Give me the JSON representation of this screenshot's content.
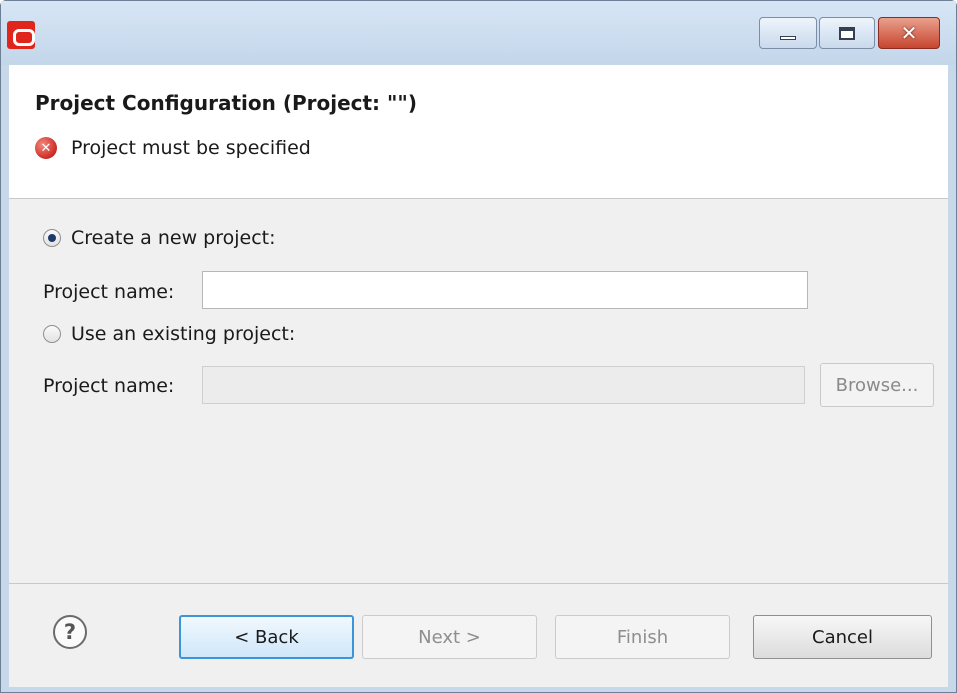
{
  "window": {
    "icon": "oracle-logo-icon",
    "controls": {
      "minimize_icon": "minimize-icon",
      "maximize_icon": "maximize-icon",
      "close_glyph": "✕"
    }
  },
  "header": {
    "title": "Project Configuration (Project: \"\")",
    "error_glyph": "✕",
    "error_message": "Project must be specified"
  },
  "form": {
    "create_new": {
      "label": "Create a new project:",
      "selected": true
    },
    "new_project_name": {
      "label": "Project name:",
      "value": ""
    },
    "use_existing": {
      "label": "Use an existing project:",
      "selected": false
    },
    "existing_project_name": {
      "label": "Project name:",
      "value": "",
      "enabled": false
    },
    "browse_label": "Browse..."
  },
  "footer": {
    "help_glyph": "?",
    "back_label": "< Back",
    "next_label": "Next >",
    "finish_label": "Finish",
    "cancel_label": "Cancel"
  },
  "colors": {
    "error": "#d0302a",
    "focus_border": "#3c95d6",
    "app_icon": "#e0261c"
  }
}
